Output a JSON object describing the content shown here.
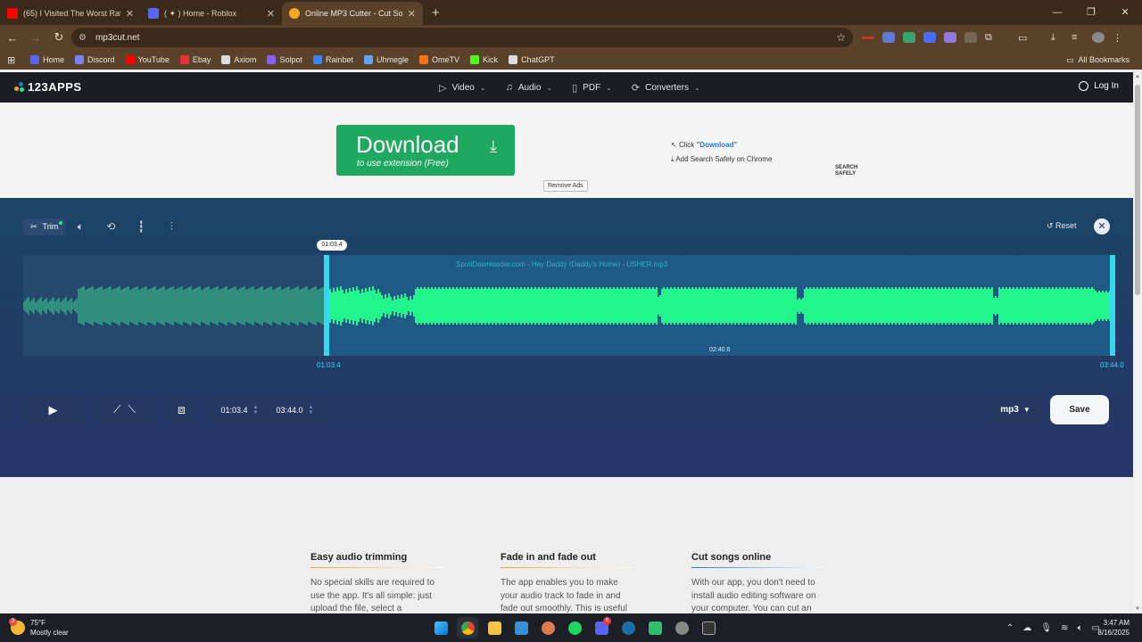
{
  "browser": {
    "tabs": [
      {
        "title": "(65) I Visited The Worst Rated C",
        "color": "#ff0000"
      },
      {
        "title": "( ✦ ) Home - Roblox",
        "color": "#5865f2"
      },
      {
        "title": "Online MP3 Cutter - Cut Songs, ",
        "color": "#f5a623"
      }
    ],
    "url": "mp3cut.net",
    "bookmarks": [
      {
        "label": "Home",
        "color": "#5865f2"
      },
      {
        "label": "Discord",
        "color": "#7983f5"
      },
      {
        "label": "YouTube",
        "color": "#ff0000"
      },
      {
        "label": "Ebay",
        "color": "#e53238"
      },
      {
        "label": "Axiom",
        "color": "#dddddd"
      },
      {
        "label": "Solpot",
        "color": "#8b5cf6"
      },
      {
        "label": "Rainbet",
        "color": "#3b82f6"
      },
      {
        "label": "Uhmegle",
        "color": "#60a5fa"
      },
      {
        "label": "OmeTV",
        "color": "#f97316"
      },
      {
        "label": "Kick",
        "color": "#53fc18"
      },
      {
        "label": "ChatGPT",
        "color": "#dddddd"
      }
    ],
    "all_bookmarks": "All Bookmarks"
  },
  "site": {
    "logo": "123APPS",
    "nav": [
      {
        "label": "Video",
        "icon": "video-icon"
      },
      {
        "label": "Audio",
        "icon": "music-note-icon"
      },
      {
        "label": "PDF",
        "icon": "document-icon"
      },
      {
        "label": "Converters",
        "icon": "refresh-icon"
      }
    ],
    "login": "Log In"
  },
  "ad": {
    "download_label": "Download",
    "download_sub": "to use extension (Free)",
    "step1_prefix": "Click ",
    "step1_highlight": "\"Download\"",
    "step2": "Add Search Safely on Chrome",
    "brand_line1": "SEARCH",
    "brand_line2": "SAFELY",
    "remove_ads": "Remove Ads"
  },
  "editor": {
    "trim_label": "Trim",
    "reset_label": "Reset",
    "filename": "SpotiDownloader.com - Hey Daddy (Daddy's Home) - USHER.mp3",
    "start_tag": "01:03.4",
    "start_time": "01:03.4",
    "end_time": "03:44.0",
    "mid_time": "02:40.6",
    "duration_selected_start": 0.277,
    "selection_end": 0.998,
    "format": "mp3",
    "save_label": "Save",
    "accent_color": "#22f58c",
    "dim_color": "#2f8f7c"
  },
  "features": [
    {
      "title": "Easy audio trimming",
      "text": "No special skills are required to use the app. It's all simple: just upload the file, select a"
    },
    {
      "title": "Fade in and fade out",
      "text": "The app enables you to make your audio track to fade in and fade out smoothly. This is useful"
    },
    {
      "title": "Cut songs online",
      "text": "With our app, you don't need to install audio editing software on your computer. You can cut an"
    }
  ],
  "taskbar": {
    "temp": "75°F",
    "condition": "Mostly clear",
    "weather_badge": "3",
    "time": "3:47 AM",
    "date": "8/16/2025",
    "discord_badge": "6"
  }
}
